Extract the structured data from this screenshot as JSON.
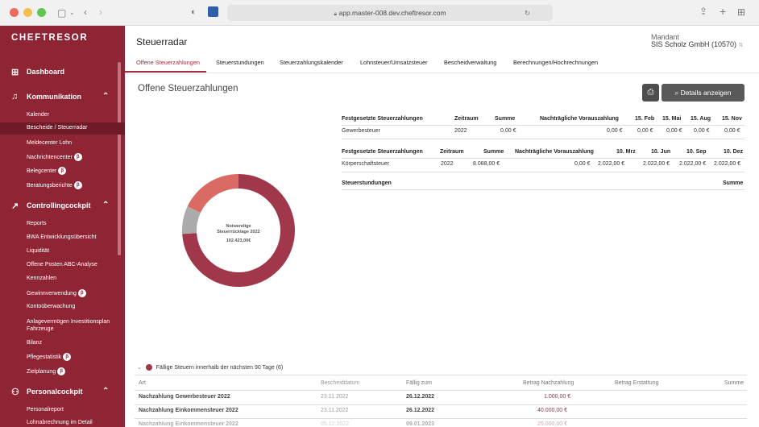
{
  "browser": {
    "url": "app.master-008.dev.cheftresor.com"
  },
  "sidebar": {
    "logo": "CHEFTRESOR",
    "dashboard": "Dashboard",
    "kommunikation": {
      "label": "Kommunikation",
      "items": [
        "Kalender",
        "Bescheide / Steuerradar",
        "Meldecenter Lohn",
        "Nachrichtencenter",
        "Belegcenter",
        "Beratungsberichte"
      ]
    },
    "controlling": {
      "label": "Controllingcockpit",
      "items": [
        "Reports",
        "BWA Entwicklungsübersicht",
        "Liquidität",
        "Offene Posten ABC-Analyse",
        "Kennzahlen",
        "Gewinnverwendung",
        "Kontoüberwachung",
        "Anlagevermögen Investitionsplan Fahrzeuge",
        "Bilanz",
        "Pflegestatistik",
        "Zielplanung"
      ]
    },
    "personal": {
      "label": "Personalcockpit",
      "items": [
        "Personalreport",
        "Lohnabrechnung im Detail"
      ]
    },
    "badge": "β"
  },
  "header": {
    "title": "Steuerradar",
    "mandant_label": "Mandant",
    "mandant_value": "SIS Scholz GmbH (10570)"
  },
  "tabs": [
    "Offene Steuerzahlungen",
    "Steuerstundungen",
    "Steuerzahlungskalender",
    "Lohnsteuer/Umsatzsteuer",
    "Bescheidverwaltung",
    "Berechnungen/Hochrechnungen"
  ],
  "section_title": "Offene Steuerzahlungen",
  "details_button": "Details anzeigen",
  "donut": {
    "line1": "Notwendige",
    "line2": "Steuerrücklage 2022",
    "amount": "102.423,00€",
    "segments": [
      {
        "name": "main",
        "fraction": 0.74,
        "color": "#a0374b"
      },
      {
        "name": "grey",
        "fraction": 0.08,
        "color": "#ababab"
      },
      {
        "name": "light",
        "fraction": 0.18,
        "color": "#da6a64"
      }
    ]
  },
  "table1": {
    "headers": [
      "Festgesetzte Steuerzahlungen",
      "Zeitraum",
      "Summe",
      "Nachträgliche Vorauszahlung",
      "15. Feb",
      "15. Mai",
      "15. Aug",
      "15. Nov"
    ],
    "row": [
      "Gewerbesteuer",
      "2022",
      "0,00 €",
      "0,00 €",
      "0,00 €",
      "0,00 €",
      "0,00 €",
      "0,00 €"
    ]
  },
  "table2": {
    "headers": [
      "Festgesetzte Steuerzahlungen",
      "Zeitraum",
      "Summe",
      "Nachträgliche Vorauszahlung",
      "10. Mrz",
      "10. Jun",
      "10. Sep",
      "10. Dez"
    ],
    "row": [
      "Körperschaftsteuer",
      "2022",
      "8.088,00 €",
      "0,00 €",
      "2.022,00 €",
      "2.022,00 €",
      "2.022,00 €",
      "2.022,00 €"
    ]
  },
  "table3": {
    "headers": [
      "Steuerstundungen",
      "Summe"
    ]
  },
  "due": {
    "title": "Fällige Steuern innerhalb der nächsten 90 Tage (6)",
    "headers": [
      "Art",
      "Bescheiddatum",
      "Fällig zum",
      "Betrag Nachzahlung",
      "Betrag Erstattung",
      "Summe"
    ],
    "rows": [
      [
        "Nachzahlung Gewerbesteuer 2022",
        "23.11.2022",
        "26.12.2022",
        "1.000,00 €"
      ],
      [
        "Nachzahlung Einkommensteuer 2022",
        "23.11.2022",
        "26.12.2022",
        "40.000,00 €"
      ],
      [
        "Nachzahlung Einkommensteuer 2022",
        "05.12.2022",
        "09.01.2023",
        "25.000,00 €"
      ]
    ]
  }
}
